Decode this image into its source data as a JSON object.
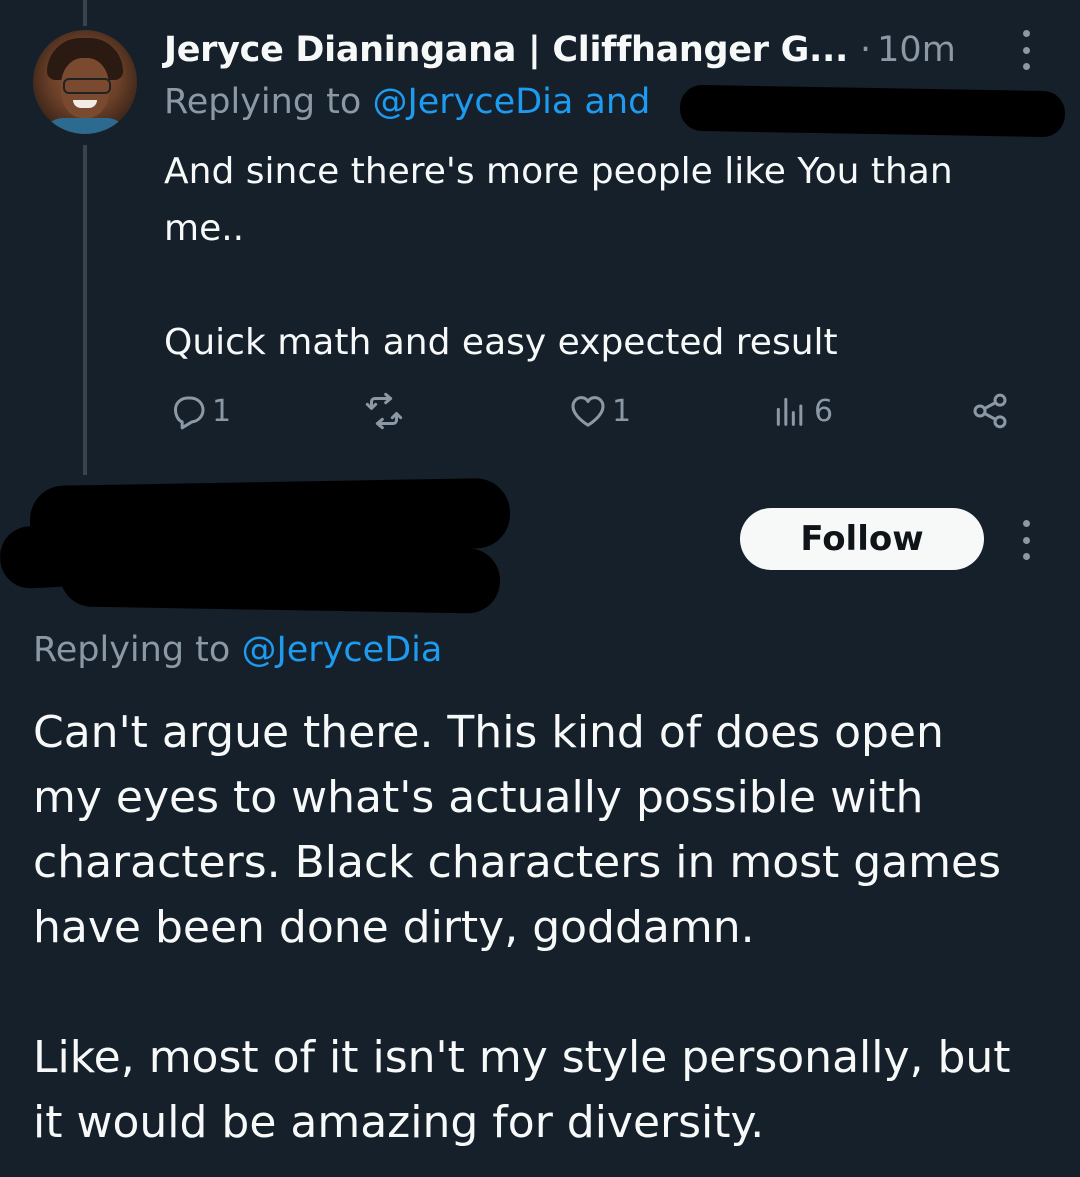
{
  "tweet1": {
    "author_name": "Jeryce Dianingana | Cliffhanger G...",
    "separator": "·",
    "timestamp": "10m",
    "replying_prefix": "Replying to ",
    "replying_mention": "@JeryceDia and",
    "text": "And since there's more people like You than\nme..\n\nQuick math and easy expected result",
    "actions": {
      "replies": "1",
      "likes": "1",
      "views": "6"
    }
  },
  "tweet2": {
    "follow_label": "Follow",
    "replying_prefix": "Replying to ",
    "replying_mention": "@JeryceDia",
    "text": "Can't argue there. This kind of does open\nmy eyes to what's actually possible with\ncharacters. Black characters in most games\nhave been done dirty, goddamn.\n\nLike, most of it isn't my style personally, but\nit would be amazing for diversity."
  },
  "colors": {
    "background": "#15202b",
    "primary_text": "#f7f9f9",
    "secondary_text": "#8b98a5",
    "accent": "#1d9bf0",
    "thread_line": "#38444d"
  },
  "icons": [
    "more-icon",
    "reply-icon",
    "retweet-icon",
    "like-icon",
    "views-icon",
    "share-icon"
  ]
}
